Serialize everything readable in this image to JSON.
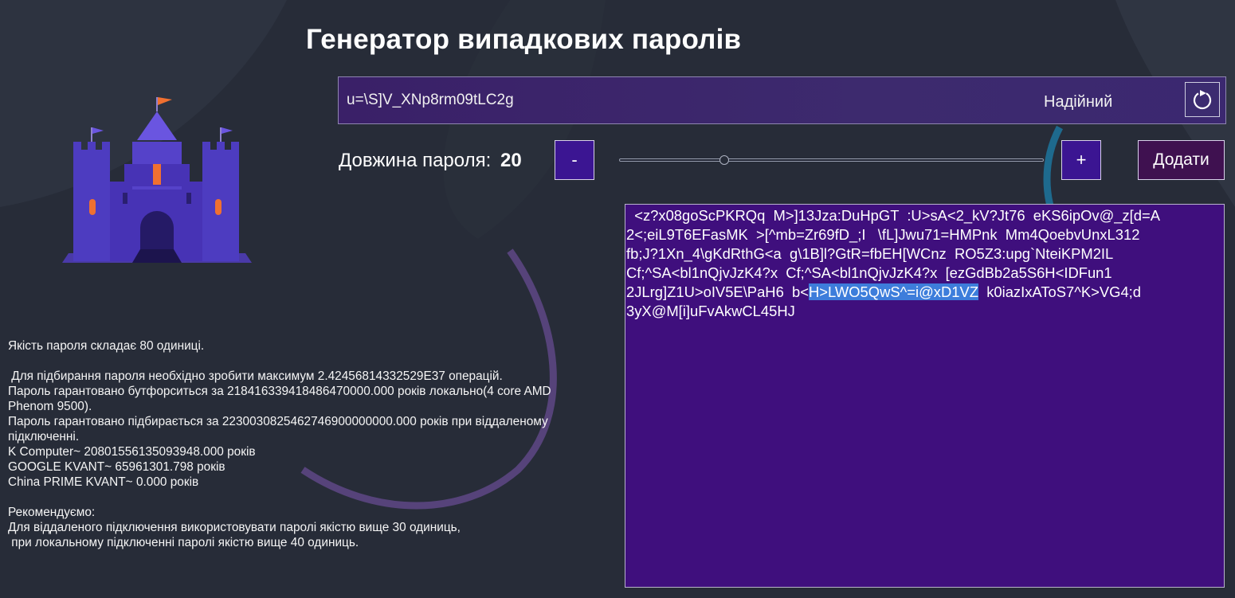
{
  "app": {
    "title": "Генератор випадкових паролів"
  },
  "password_bar": {
    "value": "u=\\S]V_XNp8rm09tLC2g",
    "strength": "Надійний",
    "refresh_icon": "refresh-icon"
  },
  "length_control": {
    "label": "Довжина пароля:",
    "value": "20",
    "minus_label": "-",
    "plus_label": "+",
    "slider_level_fraction": 0.24,
    "add_label": "Додати"
  },
  "password_list": {
    "lines": [
      "  <z?x08goScPKRQq  M>]13Jza:DuHpGT  :U>sA<2_kV?Jt76  eKS6ipOv@_z[d=A",
      "2<;eiL9T6EFasMK  >[^mb=Zr69fD_;I   \\fL]Jwu71=HMPnk  Mm4QoebvUnxL312",
      "fb;J?1Xn_4\\gKdRthG<a  g\\1B]l?GtR=fbEH[WCnz  RO5Z3:upg`NteiKPM2IL",
      "Cf;^SA<bl1nQjvJzK4?x  Cf;^SA<bl1nQjvJzK4?x  [ezGdBb2a5S6H<IDFun1",
      "3yX@M[i]uFvAkwCL45HJ"
    ],
    "line5_before": "2JLrg]Z1U>oIV5E\\PaH6  b<",
    "line5_selected": "H>LWO5QwS^=i@xD1VZ",
    "line5_after": "  k0iazIxAToS7^K>VG4;d"
  },
  "info": {
    "quality": "Якість пароля складає 80 одиниці.",
    "operations": " Для підбирання пароля необхідно зробити максимум 2.42456814332529E37 операцій.",
    "local": "Пароль гарантовано бутфорситься за 218416339418486470000.000 років локально(4 core AMD Phenom 9500).",
    "remote": "Пароль гарантовано підбирається за 2230030825462746900000000.000 років при віддаленому підключенні.",
    "k_computer": "K Computer~ 20801556135093948.000 років",
    "google": "GOOGLE KVANT~ 65961301.798 років",
    "china": "China PRIME KVANT~ 0.000 років",
    "recommend_title": "Рекомендуємо:",
    "recommend_1": "Для віддаленого підключення використовувати паролі якістю вище 30 одиниць,",
    "recommend_2": " при локальному підключенні паролі якістю вище 40 одиниць."
  },
  "colors": {
    "background": "#272c38",
    "accent_purple": "#3f0f7d",
    "button_purple": "#3b1592"
  }
}
